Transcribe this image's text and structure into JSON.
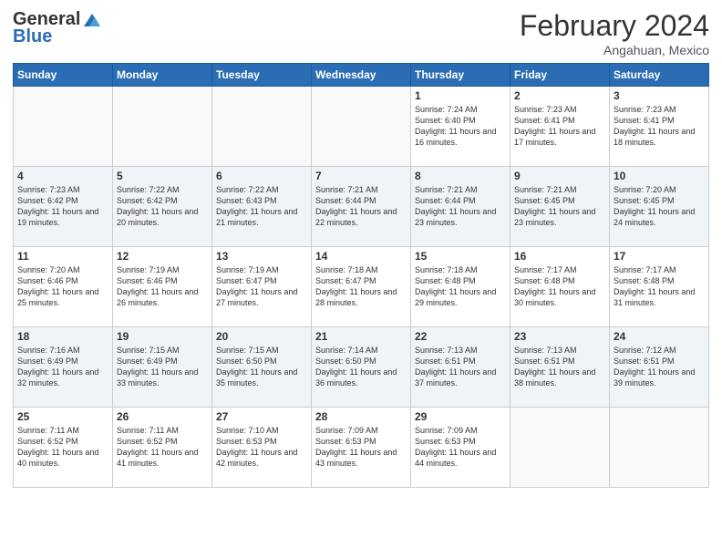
{
  "header": {
    "logo_general": "General",
    "logo_blue": "Blue",
    "month_title": "February 2024",
    "location": "Angahuan, Mexico"
  },
  "weekdays": [
    "Sunday",
    "Monday",
    "Tuesday",
    "Wednesday",
    "Thursday",
    "Friday",
    "Saturday"
  ],
  "weeks": [
    [
      {
        "day": "",
        "sunrise": "",
        "sunset": "",
        "daylight": "",
        "empty": true
      },
      {
        "day": "",
        "sunrise": "",
        "sunset": "",
        "daylight": "",
        "empty": true
      },
      {
        "day": "",
        "sunrise": "",
        "sunset": "",
        "daylight": "",
        "empty": true
      },
      {
        "day": "",
        "sunrise": "",
        "sunset": "",
        "daylight": "",
        "empty": true
      },
      {
        "day": "1",
        "sunrise": "Sunrise: 7:24 AM",
        "sunset": "Sunset: 6:40 PM",
        "daylight": "Daylight: 11 hours and 16 minutes.",
        "empty": false
      },
      {
        "day": "2",
        "sunrise": "Sunrise: 7:23 AM",
        "sunset": "Sunset: 6:41 PM",
        "daylight": "Daylight: 11 hours and 17 minutes.",
        "empty": false
      },
      {
        "day": "3",
        "sunrise": "Sunrise: 7:23 AM",
        "sunset": "Sunset: 6:41 PM",
        "daylight": "Daylight: 11 hours and 18 minutes.",
        "empty": false
      }
    ],
    [
      {
        "day": "4",
        "sunrise": "Sunrise: 7:23 AM",
        "sunset": "Sunset: 6:42 PM",
        "daylight": "Daylight: 11 hours and 19 minutes.",
        "empty": false
      },
      {
        "day": "5",
        "sunrise": "Sunrise: 7:22 AM",
        "sunset": "Sunset: 6:42 PM",
        "daylight": "Daylight: 11 hours and 20 minutes.",
        "empty": false
      },
      {
        "day": "6",
        "sunrise": "Sunrise: 7:22 AM",
        "sunset": "Sunset: 6:43 PM",
        "daylight": "Daylight: 11 hours and 21 minutes.",
        "empty": false
      },
      {
        "day": "7",
        "sunrise": "Sunrise: 7:21 AM",
        "sunset": "Sunset: 6:44 PM",
        "daylight": "Daylight: 11 hours and 22 minutes.",
        "empty": false
      },
      {
        "day": "8",
        "sunrise": "Sunrise: 7:21 AM",
        "sunset": "Sunset: 6:44 PM",
        "daylight": "Daylight: 11 hours and 23 minutes.",
        "empty": false
      },
      {
        "day": "9",
        "sunrise": "Sunrise: 7:21 AM",
        "sunset": "Sunset: 6:45 PM",
        "daylight": "Daylight: 11 hours and 23 minutes.",
        "empty": false
      },
      {
        "day": "10",
        "sunrise": "Sunrise: 7:20 AM",
        "sunset": "Sunset: 6:45 PM",
        "daylight": "Daylight: 11 hours and 24 minutes.",
        "empty": false
      }
    ],
    [
      {
        "day": "11",
        "sunrise": "Sunrise: 7:20 AM",
        "sunset": "Sunset: 6:46 PM",
        "daylight": "Daylight: 11 hours and 25 minutes.",
        "empty": false
      },
      {
        "day": "12",
        "sunrise": "Sunrise: 7:19 AM",
        "sunset": "Sunset: 6:46 PM",
        "daylight": "Daylight: 11 hours and 26 minutes.",
        "empty": false
      },
      {
        "day": "13",
        "sunrise": "Sunrise: 7:19 AM",
        "sunset": "Sunset: 6:47 PM",
        "daylight": "Daylight: 11 hours and 27 minutes.",
        "empty": false
      },
      {
        "day": "14",
        "sunrise": "Sunrise: 7:18 AM",
        "sunset": "Sunset: 6:47 PM",
        "daylight": "Daylight: 11 hours and 28 minutes.",
        "empty": false
      },
      {
        "day": "15",
        "sunrise": "Sunrise: 7:18 AM",
        "sunset": "Sunset: 6:48 PM",
        "daylight": "Daylight: 11 hours and 29 minutes.",
        "empty": false
      },
      {
        "day": "16",
        "sunrise": "Sunrise: 7:17 AM",
        "sunset": "Sunset: 6:48 PM",
        "daylight": "Daylight: 11 hours and 30 minutes.",
        "empty": false
      },
      {
        "day": "17",
        "sunrise": "Sunrise: 7:17 AM",
        "sunset": "Sunset: 6:48 PM",
        "daylight": "Daylight: 11 hours and 31 minutes.",
        "empty": false
      }
    ],
    [
      {
        "day": "18",
        "sunrise": "Sunrise: 7:16 AM",
        "sunset": "Sunset: 6:49 PM",
        "daylight": "Daylight: 11 hours and 32 minutes.",
        "empty": false
      },
      {
        "day": "19",
        "sunrise": "Sunrise: 7:15 AM",
        "sunset": "Sunset: 6:49 PM",
        "daylight": "Daylight: 11 hours and 33 minutes.",
        "empty": false
      },
      {
        "day": "20",
        "sunrise": "Sunrise: 7:15 AM",
        "sunset": "Sunset: 6:50 PM",
        "daylight": "Daylight: 11 hours and 35 minutes.",
        "empty": false
      },
      {
        "day": "21",
        "sunrise": "Sunrise: 7:14 AM",
        "sunset": "Sunset: 6:50 PM",
        "daylight": "Daylight: 11 hours and 36 minutes.",
        "empty": false
      },
      {
        "day": "22",
        "sunrise": "Sunrise: 7:13 AM",
        "sunset": "Sunset: 6:51 PM",
        "daylight": "Daylight: 11 hours and 37 minutes.",
        "empty": false
      },
      {
        "day": "23",
        "sunrise": "Sunrise: 7:13 AM",
        "sunset": "Sunset: 6:51 PM",
        "daylight": "Daylight: 11 hours and 38 minutes.",
        "empty": false
      },
      {
        "day": "24",
        "sunrise": "Sunrise: 7:12 AM",
        "sunset": "Sunset: 6:51 PM",
        "daylight": "Daylight: 11 hours and 39 minutes.",
        "empty": false
      }
    ],
    [
      {
        "day": "25",
        "sunrise": "Sunrise: 7:11 AM",
        "sunset": "Sunset: 6:52 PM",
        "daylight": "Daylight: 11 hours and 40 minutes.",
        "empty": false
      },
      {
        "day": "26",
        "sunrise": "Sunrise: 7:11 AM",
        "sunset": "Sunset: 6:52 PM",
        "daylight": "Daylight: 11 hours and 41 minutes.",
        "empty": false
      },
      {
        "day": "27",
        "sunrise": "Sunrise: 7:10 AM",
        "sunset": "Sunset: 6:53 PM",
        "daylight": "Daylight: 11 hours and 42 minutes.",
        "empty": false
      },
      {
        "day": "28",
        "sunrise": "Sunrise: 7:09 AM",
        "sunset": "Sunset: 6:53 PM",
        "daylight": "Daylight: 11 hours and 43 minutes.",
        "empty": false
      },
      {
        "day": "29",
        "sunrise": "Sunrise: 7:09 AM",
        "sunset": "Sunset: 6:53 PM",
        "daylight": "Daylight: 11 hours and 44 minutes.",
        "empty": false
      },
      {
        "day": "",
        "sunrise": "",
        "sunset": "",
        "daylight": "",
        "empty": true
      },
      {
        "day": "",
        "sunrise": "",
        "sunset": "",
        "daylight": "",
        "empty": true
      }
    ]
  ]
}
